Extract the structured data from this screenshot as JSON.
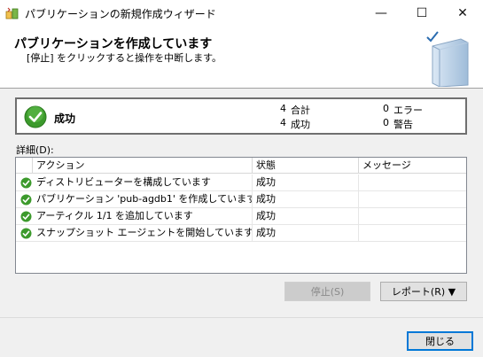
{
  "window": {
    "title": "パブリケーションの新規作成ウィザード",
    "minimize": "—",
    "maximize": "☐",
    "close": "✕"
  },
  "header": {
    "title": "パブリケーションを作成しています",
    "subtitle": "[停止] をクリックすると操作を中断します。"
  },
  "status": {
    "label": "成功",
    "total_count": "4",
    "total_label": "合計",
    "success_count": "4",
    "success_label": "成功",
    "error_count": "0",
    "error_label": "エラー",
    "warning_count": "0",
    "warning_label": "警告"
  },
  "details": {
    "label": "詳細(D):",
    "columns": [
      "アクション",
      "状態",
      "メッセージ"
    ],
    "rows": [
      {
        "action": "ディストリビューターを構成しています",
        "status": "成功",
        "message": ""
      },
      {
        "action": "パブリケーション 'pub-agdb1' を作成しています",
        "status": "成功",
        "message": ""
      },
      {
        "action": "アーティクル 1/1 を追加しています",
        "status": "成功",
        "message": ""
      },
      {
        "action": "スナップショット エージェントを開始しています",
        "status": "成功",
        "message": ""
      }
    ]
  },
  "buttons": {
    "stop": "停止(S)",
    "report": "レポート(R) ▼",
    "close": "閉じる"
  },
  "colors": {
    "success_green": "#3c9a2c",
    "accent_blue": "#0078d7"
  }
}
